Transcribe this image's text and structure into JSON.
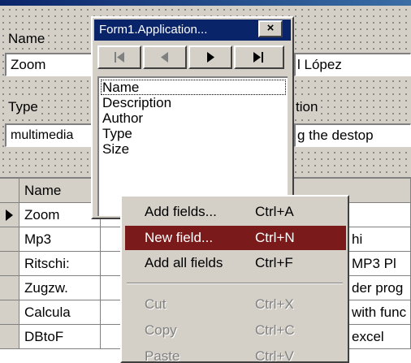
{
  "form": {
    "name_label": "Name",
    "name_value": "Zoom",
    "name_value2": "l López",
    "type_label": "Type",
    "type_value": "multimedia",
    "desc_label": "tion",
    "desc_value": "g the destop"
  },
  "grid": {
    "header": "Name",
    "rows": [
      {
        "name": "Zoom",
        "right": ""
      },
      {
        "name": "Mp3",
        "right": "hi"
      },
      {
        "name": "Ritschi:",
        "right": "MP3 Pl"
      },
      {
        "name": "Zugzw.",
        "right": "der prog"
      },
      {
        "name": "Calcula",
        "right": "with func"
      },
      {
        "name": "DBtoF",
        "right": "excel"
      }
    ]
  },
  "popup": {
    "title": "Form1.Application...",
    "close": "×",
    "fields": [
      "Name",
      "Description",
      "Author",
      "Type",
      "Size"
    ]
  },
  "menu": {
    "items": [
      {
        "label": "Add fields...",
        "shortcut": "Ctrl+A"
      },
      {
        "label": "New field...",
        "shortcut": "Ctrl+N"
      },
      {
        "label": "Add all fields",
        "shortcut": "Ctrl+F"
      },
      {
        "label": "Cut",
        "shortcut": "Ctrl+X"
      },
      {
        "label": "Copy",
        "shortcut": "Ctrl+C"
      },
      {
        "label": "Paste",
        "shortcut": "Ctrl+V"
      }
    ]
  },
  "colors": {
    "highlight": "#7b1a1a",
    "titlebar": "#0a246a"
  }
}
